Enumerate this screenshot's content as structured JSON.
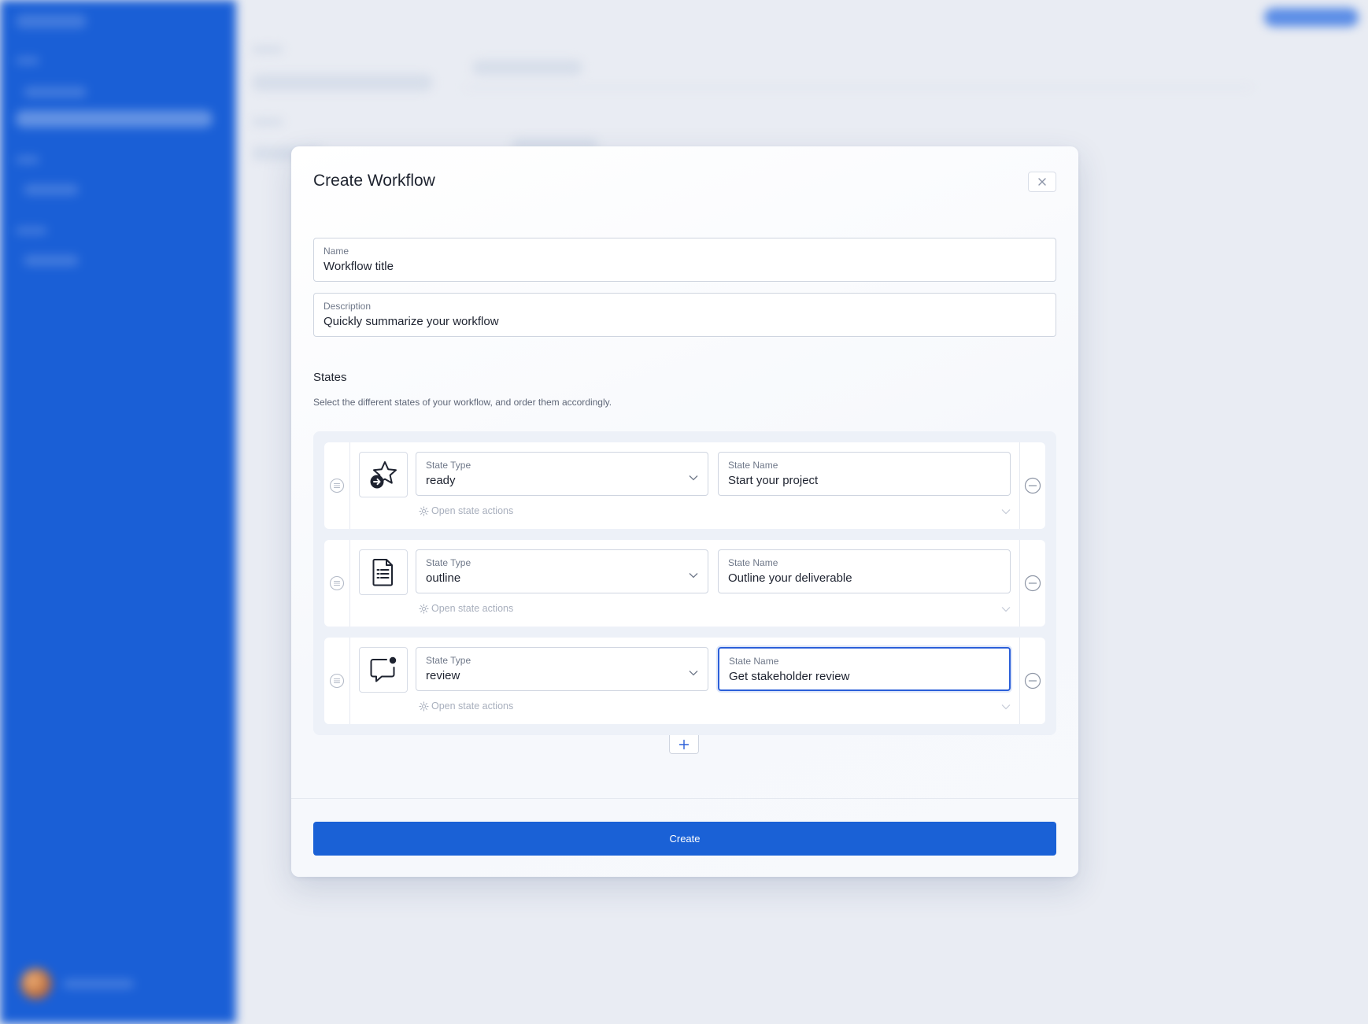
{
  "modal": {
    "title": "Create Workflow",
    "close_icon": "close-icon",
    "name_field": {
      "label": "Name",
      "value": "Workflow title"
    },
    "description_field": {
      "label": "Description",
      "value": "Quickly summarize your workflow"
    },
    "states_section": {
      "title": "States",
      "description": "Select the different states of your workflow, and order them accordingly."
    },
    "states": [
      {
        "icon": "star-arrow-icon",
        "type_label": "State Type",
        "type_value": "ready",
        "name_label": "State Name",
        "name_value": "Start your project",
        "actions_label": "Open state actions",
        "focused": false
      },
      {
        "icon": "document-list-icon",
        "type_label": "State Type",
        "type_value": "outline",
        "name_label": "State Name",
        "name_value": "Outline your deliverable",
        "actions_label": "Open state actions",
        "focused": false
      },
      {
        "icon": "chat-notification-icon",
        "type_label": "State Type",
        "type_value": "review",
        "name_label": "State Name",
        "name_value": "Get stakeholder review",
        "actions_label": "Open state actions",
        "focused": true
      }
    ],
    "add_state_icon": "plus-icon",
    "submit_label": "Create"
  },
  "colors": {
    "accent": "#1a61d6",
    "sidebar": "#1a5fd6",
    "focus_border": "#2b5fd9",
    "text_primary": "#1f2430",
    "text_muted": "#a8afbd"
  }
}
